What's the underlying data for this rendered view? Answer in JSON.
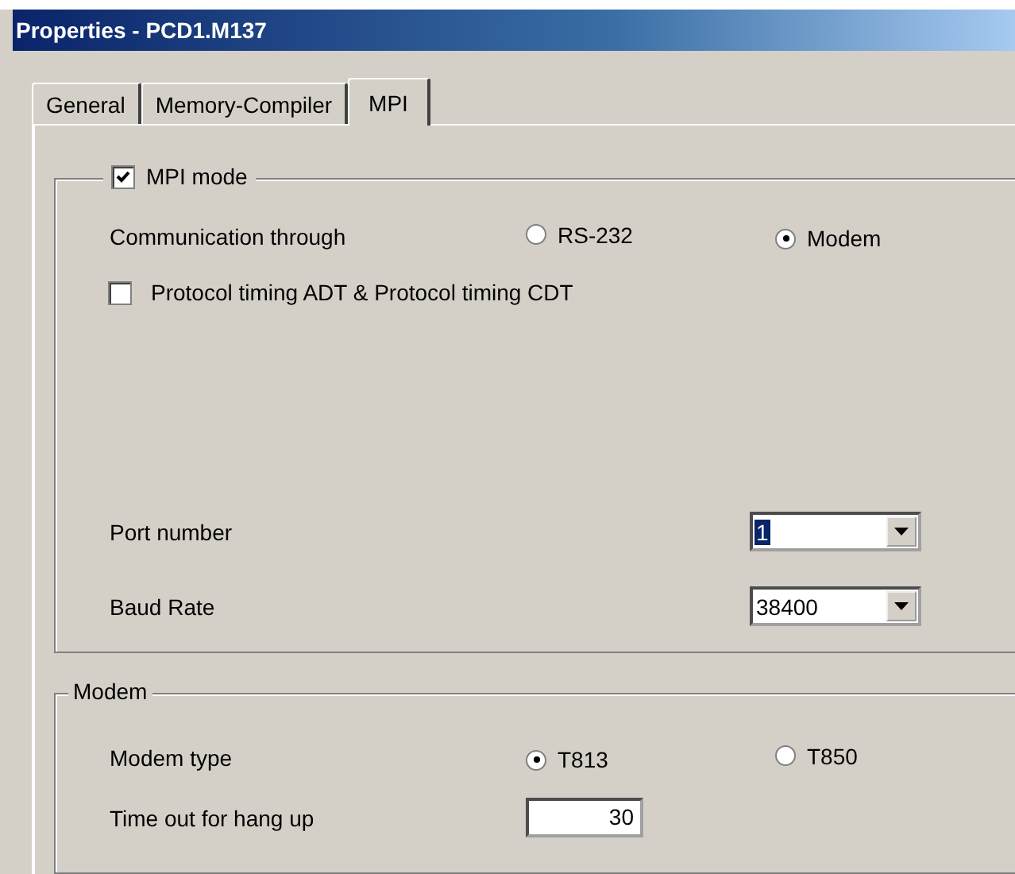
{
  "window": {
    "title": "Properties - PCD1.M137"
  },
  "tabs": [
    {
      "label": "General",
      "selected": false
    },
    {
      "label": "Memory-Compiler",
      "selected": false
    },
    {
      "label": "MPI",
      "selected": true
    }
  ],
  "mpi_group": {
    "label": "MPI mode",
    "checked": true,
    "communication": {
      "label": "Communication through",
      "options": [
        {
          "label": "RS-232",
          "selected": false
        },
        {
          "label": "Modem",
          "selected": true
        }
      ]
    },
    "protocol_timing": {
      "label": "Protocol timing ADT & Protocol timing CDT",
      "checked": false
    },
    "port_number": {
      "label": "Port number",
      "value": "1",
      "value_selected": true
    },
    "baud_rate": {
      "label": "Baud Rate",
      "value": "38400",
      "value_selected": false
    }
  },
  "modem_group": {
    "title": "Modem",
    "modem_type": {
      "label": "Modem type",
      "options": [
        {
          "label": "T813",
          "selected": true
        },
        {
          "label": "T850",
          "selected": false
        }
      ]
    },
    "timeout": {
      "label": "Time out for hang up",
      "value": "30"
    }
  }
}
